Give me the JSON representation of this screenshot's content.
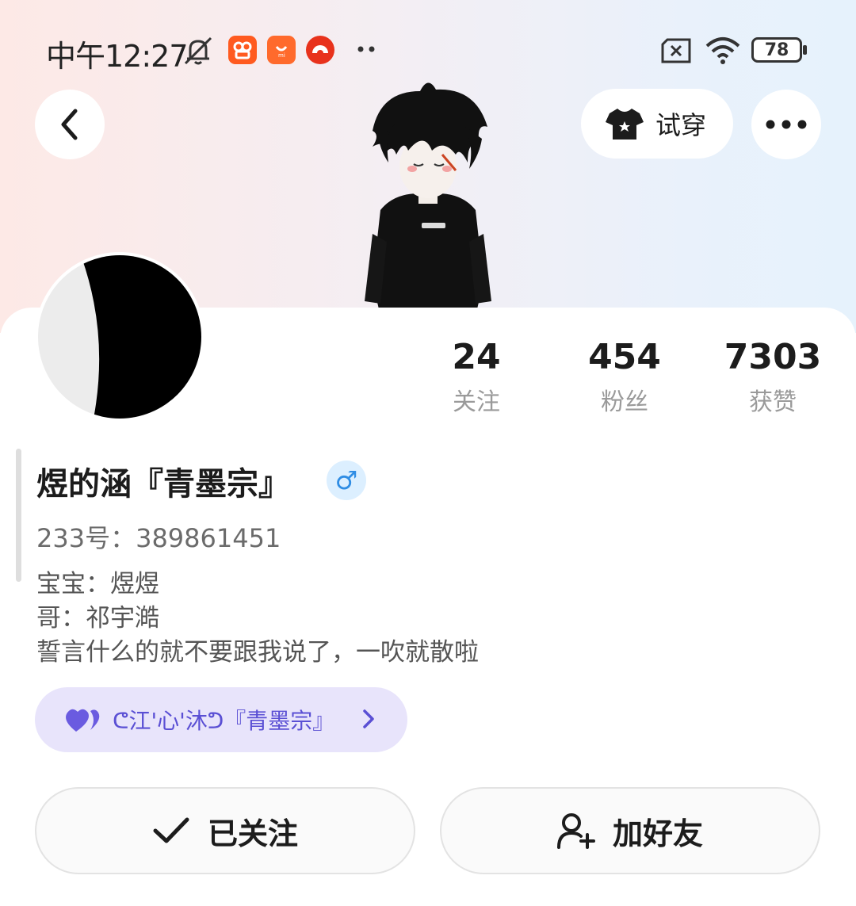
{
  "status_bar": {
    "time": "中午12:27",
    "battery": "78",
    "icons": [
      "mute-bell-icon",
      "kuaishou-app-icon",
      "mi-store-app-icon",
      "music-app-icon",
      "more-dots-icon",
      "sim-error-icon",
      "wifi-icon",
      "battery-icon"
    ]
  },
  "header": {
    "back_icon": "chevron-left-icon",
    "tryon_label": "试穿",
    "tryon_icon": "tshirt-icon",
    "more_icon": "more-horizontal-icon"
  },
  "stats": [
    {
      "value": "24",
      "label": "关注"
    },
    {
      "value": "454",
      "label": "粉丝"
    },
    {
      "value": "7303",
      "label": "获赞"
    }
  ],
  "profile": {
    "nickname": "煜的涵『青墨宗』",
    "gender_symbol": "♂",
    "uid": "233号：389861451",
    "bio": [
      "宝宝：煜煜",
      "哥：祁宇澔",
      "誓言什么的就不要跟我说了，一吹就散啦"
    ]
  },
  "group": {
    "name": "ᕦ江'心'沐ᕤ『青墨宗』",
    "icon": "double-heart-icon",
    "accent": "#5a4fd4"
  },
  "actions": {
    "followed_label": "已关注",
    "add_friend_label": "加好友"
  },
  "colors": {
    "accent_purple": "#5a4fd4",
    "gender_blue": "#2f8de4",
    "app_orange": "#ff5a1f"
  }
}
